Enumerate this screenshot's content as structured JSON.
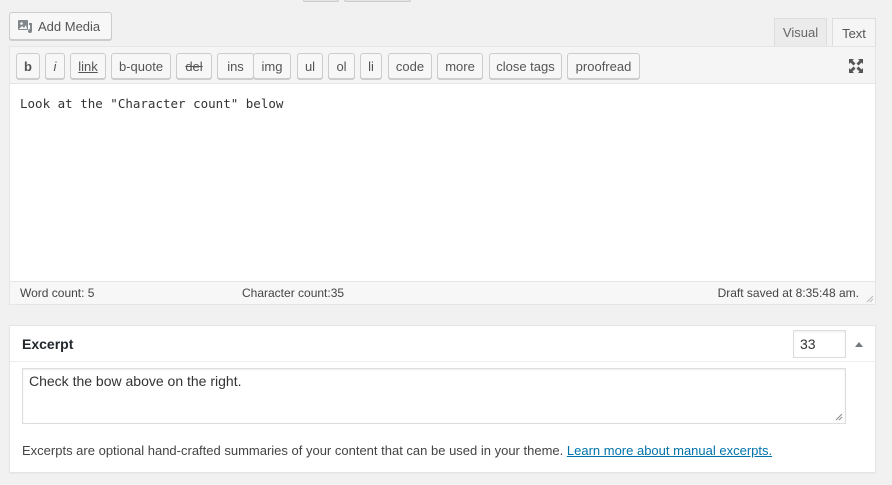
{
  "add_media": {
    "label": "Add Media",
    "icon": "media-icon"
  },
  "editor_tabs": {
    "visual": "Visual",
    "text": "Text",
    "active": "Text"
  },
  "quicktags": [
    "b",
    "i",
    "link",
    "b-quote",
    "del",
    "ins",
    "img",
    "ul",
    "ol",
    "li",
    "code",
    "more",
    "close tags",
    "proofread"
  ],
  "editor": {
    "content": "Look at the \"Character count\" below"
  },
  "status": {
    "word_count": "Word count: 5",
    "character_count": "Character count:35",
    "draft_saved": "Draft saved at 8:35:48 am."
  },
  "excerpt": {
    "title": "Excerpt",
    "counter": "33",
    "text": "Check the bow above on the right.",
    "description": "Excerpts are optional hand-crafted summaries of your content that can be used in your theme.",
    "learn_more_link": "Learn more about manual excerpts."
  },
  "colors": {
    "link": "#0073aa",
    "background": "#f1f1f1",
    "panel": "#ffffff"
  }
}
